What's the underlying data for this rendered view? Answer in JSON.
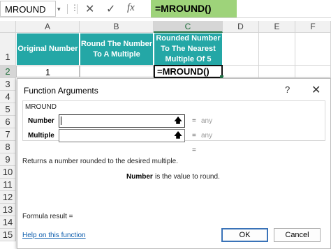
{
  "formula_bar": {
    "name_box": "MROUND",
    "name_box_arrow": "▾",
    "more_dots": "⋮",
    "cancel_icon": "✕",
    "enter_icon": "✓",
    "fx_icon": "fx",
    "formula": "=MROUND()"
  },
  "grid": {
    "columns": [
      "A",
      "B",
      "C",
      "D",
      "E",
      "F"
    ],
    "rows": [
      "1",
      "2",
      "3",
      "4",
      "5",
      "6",
      "7",
      "8",
      "9",
      "10",
      "11",
      "12",
      "13",
      "14",
      "15"
    ],
    "header_cells": {
      "a1": "Original Number",
      "b1": "Round The Number To A Multiple",
      "c1": "Rounded Number To The Nearest Multiple Of 5"
    },
    "a2": "1",
    "c2": "=MROUND()",
    "header_color": "#24a7a6"
  },
  "dialog": {
    "title": "Function Arguments",
    "help_icon": "?",
    "close_icon": "✕",
    "function_name": "MROUND",
    "args": [
      {
        "label": "Number",
        "value": "",
        "result": "any"
      },
      {
        "label": "Multiple",
        "value": "",
        "result": "any"
      }
    ],
    "collapse_icon": "🡅",
    "equals": "=",
    "description": "Returns a number rounded to the desired multiple.",
    "arg_help_name": "Number",
    "arg_help_text": "is the value to round.",
    "formula_result": "Formula result =",
    "help_link": "Help on this function",
    "ok": "OK",
    "cancel": "Cancel"
  }
}
